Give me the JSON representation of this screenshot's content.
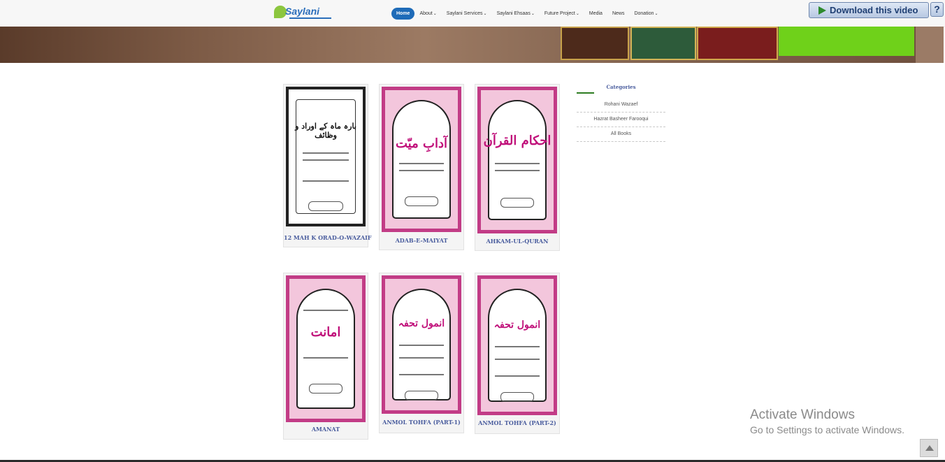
{
  "logo": {
    "text": "Saylani"
  },
  "nav": {
    "items": [
      {
        "label": "Home",
        "has_dropdown": false,
        "active": true
      },
      {
        "label": "About",
        "has_dropdown": true
      },
      {
        "label": "Saylani Services",
        "has_dropdown": true
      },
      {
        "label": "Saylani Ehsaas",
        "has_dropdown": true
      },
      {
        "label": "Future Project",
        "has_dropdown": true
      },
      {
        "label": "Media",
        "has_dropdown": false
      },
      {
        "label": "News",
        "has_dropdown": false
      },
      {
        "label": "Donation",
        "has_dropdown": true
      }
    ],
    "chevron": "⌄"
  },
  "download_button": {
    "label": "Download this video",
    "icon": "play-icon"
  },
  "help_button": {
    "label": "?"
  },
  "books": [
    {
      "title": "12 MAH K ORAD-O-WAZAIF",
      "cover_style": "bw",
      "cover_text": "بارہ ماہ کے اوراد و وظائف"
    },
    {
      "title": "ADAB-E-MAIYAT",
      "cover_style": "pink",
      "cover_text": "آدابِ میّت"
    },
    {
      "title": "AHKAM-UL-QURAN",
      "cover_style": "pink",
      "cover_text": "احکام القرآن"
    },
    {
      "title": "AMANAT",
      "cover_style": "pink",
      "cover_text": "امانت"
    },
    {
      "title": "ANMOL TOHFA (PART-1)",
      "cover_style": "pink",
      "cover_text": "انمول تحفہ"
    },
    {
      "title": "ANMOL TOHFA (PART-2)",
      "cover_style": "pink",
      "cover_text": "انمول تحفہ"
    }
  ],
  "sidebar": {
    "heading": "Categories",
    "categories": [
      "Rohani Wazaef",
      "Hazrat Basheer Farooqui",
      "All Books"
    ]
  },
  "watermark": {
    "title": "Activate Windows",
    "subtitle": "Go to Settings to activate Windows."
  },
  "colors": {
    "nav_active": "#1e6bb8",
    "book_title": "#4a5d9e",
    "cover_pink": "#c23c86",
    "sidebar_accent": "#2e7d22"
  }
}
